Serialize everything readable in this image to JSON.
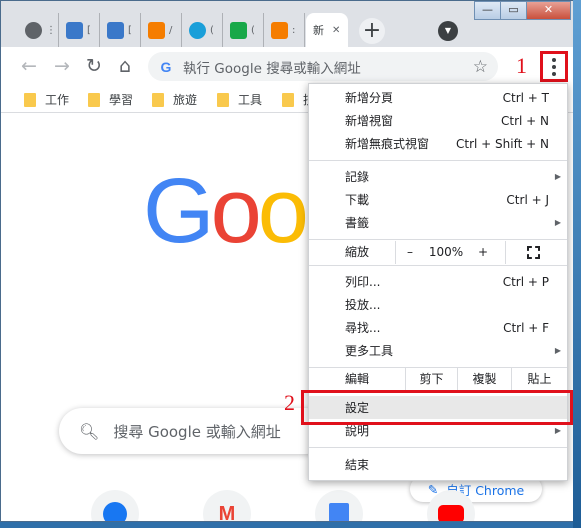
{
  "tabs": [
    {
      "favicon": "globe-icon",
      "color": "#5f6368"
    },
    {
      "favicon": "notepad-icon",
      "color": "#3a78c9",
      "text": "["
    },
    {
      "favicon": "notepad-icon",
      "color": "#3a78c9",
      "text": "["
    },
    {
      "favicon": "blogger-icon",
      "color": "#f57d00",
      "text": "/"
    },
    {
      "favicon": "pinwheel-icon",
      "color": "#1a9fd9",
      "text": "("
    },
    {
      "favicon": "game-icon",
      "color": "#18a849",
      "text": "("
    },
    {
      "favicon": "blogger-icon",
      "color": "#f57d00",
      "text": ":"
    }
  ],
  "active_tab": {
    "title": "新",
    "close": "✕"
  },
  "window_controls": {
    "minimize": "—",
    "maximize": "▭",
    "close": "✕"
  },
  "toolbar": {
    "omnibox_placeholder": "執行 Google 搜尋或輸入網址",
    "step1_label": "1",
    "step2_label": "2"
  },
  "bookmarks": [
    "工作",
    "學習",
    "旅遊",
    "工具",
    "技"
  ],
  "ntp": {
    "logo_letters": [
      "G",
      "o",
      "o"
    ],
    "logo_colors": [
      "#4285f4",
      "#ea4335",
      "#fbbc05"
    ],
    "search_placeholder": "搜尋 Google 或輸入網址",
    "customize_label": "自訂 Chrome",
    "shortcuts": [
      "facebook-icon",
      "gmail-icon",
      "google-translate-icon",
      "youtube-icon"
    ]
  },
  "menu": {
    "group1": [
      {
        "label": "新增分頁",
        "shortcut": "Ctrl + T"
      },
      {
        "label": "新增視窗",
        "shortcut": "Ctrl + N"
      },
      {
        "label": "新增無痕式視窗",
        "shortcut": "Ctrl + Shift + N"
      }
    ],
    "group2": [
      {
        "label": "記錄",
        "shortcut": ""
      },
      {
        "label": "下載",
        "shortcut": "Ctrl + J"
      },
      {
        "label": "書籤",
        "shortcut": ""
      }
    ],
    "zoom": {
      "label": "縮放",
      "minus": "–",
      "value": "100%",
      "plus": "+"
    },
    "group3": [
      {
        "label": "列印...",
        "shortcut": "Ctrl + P"
      },
      {
        "label": "投放...",
        "shortcut": ""
      },
      {
        "label": "尋找...",
        "shortcut": "Ctrl + F"
      },
      {
        "label": "更多工具",
        "shortcut": ""
      }
    ],
    "edit": {
      "label": "編輯",
      "cut": "剪下",
      "copy": "複製",
      "paste": "貼上"
    },
    "group4": [
      {
        "label": "設定"
      },
      {
        "label": "說明"
      }
    ],
    "exit": "結束"
  }
}
